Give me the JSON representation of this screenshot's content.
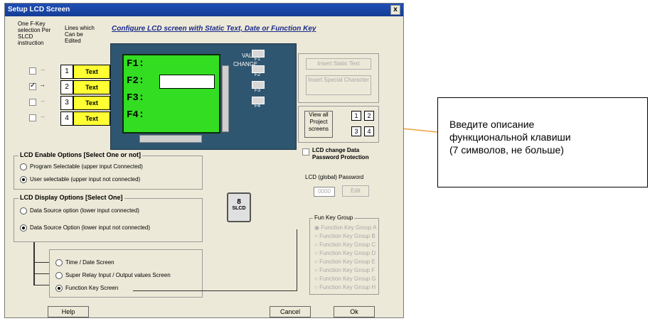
{
  "window": {
    "title": "Setup LCD Screen",
    "close_label": "x"
  },
  "header": {
    "one_fkey": "One F-Key selection Per SLCD instruction",
    "lines_edit": "Lines which Can be Edited",
    "caption": "Configure LCD screen with Static Text, Date or Function Key"
  },
  "lines": [
    {
      "number": "1",
      "label": "Text",
      "checked": false
    },
    {
      "number": "2",
      "label": "Text",
      "checked": true
    },
    {
      "number": "3",
      "label": "Text",
      "checked": false
    },
    {
      "number": "4",
      "label": "Text",
      "checked": false
    }
  ],
  "lcd": {
    "lines": [
      "F1:",
      "F2:",
      "F3:",
      "F4:"
    ],
    "change_label": "CHANGE",
    "value_label": "VALUE",
    "keys": [
      "F1",
      "F2",
      "F3",
      "F4"
    ]
  },
  "right_panel": {
    "insert_static": "Insert Static Text",
    "insert_special": "Insert Special Character",
    "view_all": "View all Project screens",
    "screen_nums": [
      "1",
      "2",
      "3",
      "4"
    ],
    "lcd_change": "LCD change Data Password Protection",
    "lcd_password": "LCD (global) Password",
    "password_value": "0000",
    "edit": "Edit"
  },
  "enable": {
    "title": "LCD Enable Options [Select One or not]",
    "options": [
      {
        "label": "Program Selectable (upper input Connected)",
        "selected": false
      },
      {
        "label": "User selectable (upper input not connected)",
        "selected": true
      }
    ]
  },
  "display": {
    "title": "LCD Display Options [Select One]",
    "options": [
      {
        "label": "Data Source option (lower input connected)",
        "selected": false
      },
      {
        "label": "Data Source Option (lower input not connected)",
        "selected": true
      }
    ]
  },
  "screens": [
    {
      "label": "Time / Date Screen",
      "selected": false
    },
    {
      "label": "Super Relay Input / Output values Screen",
      "selected": false
    },
    {
      "label": "Function Key Screen",
      "selected": true
    }
  ],
  "slcd_block": {
    "top": "8",
    "bottom": "SLCD"
  },
  "fun_key_group": {
    "title": "Fun Key Group",
    "items": [
      "Function Key Group A",
      "Function Key Group B",
      "Function Key Group C",
      "Function Key Group D",
      "Function Key Group E",
      "Function Key Group F",
      "Function Key Group G",
      "Function Key Group H"
    ]
  },
  "buttons": {
    "help": "Help",
    "cancel": "Cancel",
    "ok": "Ok"
  },
  "callout": {
    "text_lines": [
      "Введите описание",
      "функциональной клавиши",
      "(7 символов, не больше)"
    ]
  },
  "colors": {
    "lcd_screen": "#33dd22",
    "line_buttons": "#ffff33",
    "title_bar": "#1f4fb5",
    "callout_arrow": "#f0a040"
  }
}
